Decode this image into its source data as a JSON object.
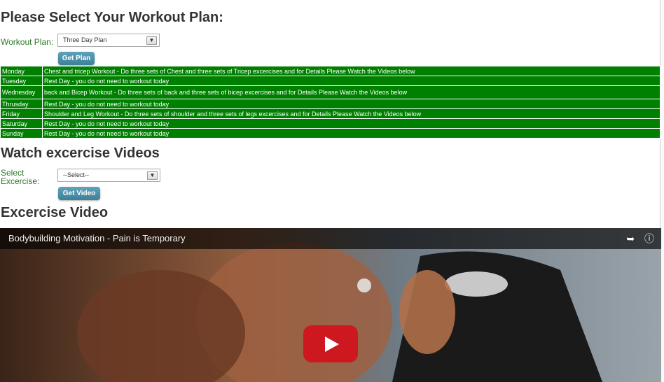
{
  "page": {
    "title": "Please Select Your Workout Plan:"
  },
  "plan_form": {
    "label": "Workout Plan:",
    "selected": "Three Day Plan",
    "button": "Get Plan"
  },
  "schedule": [
    {
      "day": "Monday",
      "text": "Chest and tricep Workout - Do three sets of Chest and three sets of Tricep excercises and for Details Please Watch the Videos below"
    },
    {
      "day": "Tuesday",
      "text": "Rest Day - you do not need to workout today"
    },
    {
      "day": "Wednesday",
      "text": "back and Bicep Workout - Do three sets of back and three sets of bicep excercises and for Details Please Watch the Videos below"
    },
    {
      "day": "Thrusday",
      "text": "Rest Day - you do not need to workout today"
    },
    {
      "day": "Friday",
      "text": "Shoulder and Leg Workout - Do three sets of shoulder and three sets of legs excercises and for Details Please Watch the Videos below"
    },
    {
      "day": "Saturday",
      "text": "Rest Day - you do not need to workout today"
    },
    {
      "day": "Sunday",
      "text": "Rest Day - you do not need to workout today"
    }
  ],
  "videos_section": {
    "title": "Watch excercise Videos",
    "label": "Select Excercise:",
    "selected": "--Select--",
    "button": "Get Video"
  },
  "video_section": {
    "title": "Excercise Video",
    "video_title": "Bodybuilding Motivation - Pain is Temporary"
  },
  "colors": {
    "table_bg": "#008000",
    "button_bg": "#4a8ea8",
    "play_red": "#cc181e"
  }
}
